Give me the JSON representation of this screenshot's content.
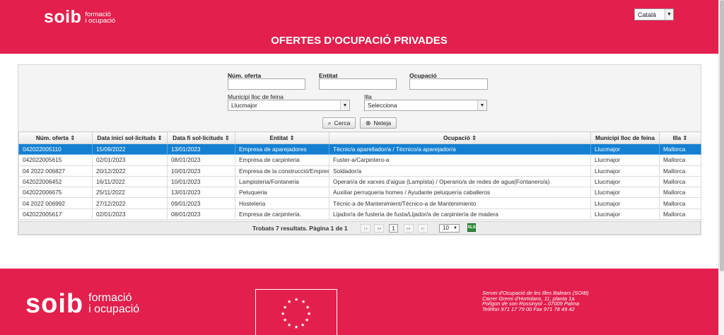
{
  "header": {
    "logo_word": "soib",
    "logo_line1": "formació",
    "logo_line2": "i ocupació",
    "language": "Català",
    "title": "OFERTES D’OCUPACIÓ PRIVADES"
  },
  "search": {
    "num_oferta_label": "Núm. oferta",
    "num_oferta_value": "",
    "entitat_label": "Entitat",
    "entitat_value": "",
    "ocupacio_label": "Ocupació",
    "ocupacio_value": "",
    "municipi_label": "Municipi lloc de feina",
    "municipi_value": "Llucmajor",
    "illa_label": "Illa",
    "illa_value": "Selecciona",
    "cerca_label": "Cerca",
    "neteja_label": "Neteja"
  },
  "table": {
    "columns": [
      "Núm. oferta ⇕",
      "Data inici sol·licituds ⇕",
      "Data fi sol·licituds ⇕",
      "Entitat ⇕",
      "Ocupació ⇕",
      "Municipi lloc de feina",
      "Illa ⇕"
    ],
    "rows": [
      [
        "042022005110",
        "15/09/2022",
        "13/01/2023",
        "Empresa de aparejadores",
        "Tècnic/a aparellador/a / Técnico/a aparejador/a",
        "Llucmajor",
        "Mallorca"
      ],
      [
        "042022005615",
        "02/01/2023",
        "08/01/2023",
        "Empresa de carpinteria",
        "Fuster-a/Carpintero-a",
        "Llucmajor",
        "Mallorca"
      ],
      [
        "04 2022 006827",
        "20/12/2022",
        "10/01/2023",
        "Empresa de la construcció/Empresa",
        "Soldador/a",
        "Llucmajor",
        "Mallorca"
      ],
      [
        "042022006452",
        "16/11/2022",
        "10/01/2023",
        "Lampisteria/Fontaneria",
        "Operari/a de xarxes d'aigua (Lampista) / Operario/a de redes de agua(Fontanero/a)",
        "Llucmajor",
        "Mallorca"
      ],
      [
        "042022006675",
        "25/11/2022",
        "13/01/2023",
        "Peluqueria",
        "Auxiliar perruqueria homes / Ayudante peluquería caballeros",
        "Llucmajor",
        "Mallorca"
      ],
      [
        "04 2022 006992",
        "27/12/2022",
        "09/01/2023",
        "Hosteleria",
        "Tècnic-a de Mantenimient/Técnico-a de Mantenimiento",
        "Llucmajor",
        "Mallorca"
      ],
      [
        "042022005617",
        "02/01/2023",
        "08/01/2023",
        "Empresa de carpinteria.",
        "Lijador/a de fusteria de fusta/Lijador/a de carpintería de madera",
        "Llucmajor",
        "Mallorca"
      ]
    ],
    "selected_row": 0
  },
  "pager": {
    "summary": "Trobats 7 resultats. Pàgina 1 de 1",
    "current_page": "1",
    "page_size": "10",
    "first": "|◂",
    "prev": "◂◂",
    "next": "▸▸",
    "last": "▸|",
    "excel": "XLS"
  },
  "footer": {
    "logo_word": "soib",
    "logo_line1": "formació",
    "logo_line2": "i ocupació",
    "address_line1": "Servei d'Ocupació de les Illes Balears (SOIB)",
    "address_line2": "Carrer Gremi d'Hortolans, 11, planta 1a",
    "address_line3": "Polígon de son Rossinyol – 07009 Palma",
    "address_line4": "Telèfon 971 17 79 00 Fax 971 78 49 42"
  },
  "colors": {
    "brand": "#e21f4d",
    "selected_row": "#1480d2"
  },
  "icons": [
    "search-icon",
    "clear-icon",
    "excel-icon",
    "eu-flag-icon",
    "chevron-down-icon"
  ]
}
